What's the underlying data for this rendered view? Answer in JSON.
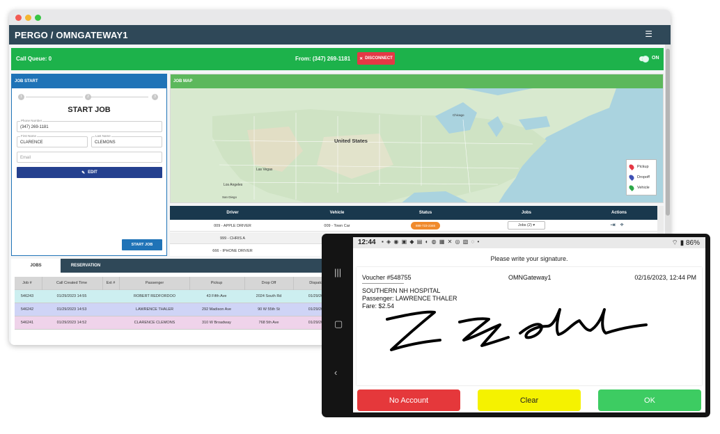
{
  "app": {
    "title": "PERGO / OMNGATEWAY1",
    "menu_icon": "hamburger-icon"
  },
  "callbar": {
    "queue": "Call Queue: 0",
    "from": "From: (347) 269-1181",
    "disconnect": "DISCONNECT",
    "toggle_label": "ON",
    "color": "#1db24b"
  },
  "job_start": {
    "header": "JOB START",
    "steps": [
      "1",
      "2",
      "3"
    ],
    "heading": "START JOB",
    "phone": {
      "label": "Phone Number",
      "value": "(347) 269-1181"
    },
    "first_name": {
      "label": "First Name",
      "value": "CLARENCE"
    },
    "last_name": {
      "label": "Last Name",
      "value": "CLEMONS"
    },
    "email": {
      "placeholder": "Email"
    },
    "edit": "EDIT",
    "start": "START JOB"
  },
  "job_map": {
    "header": "JOB MAP",
    "labels": {
      "country": "United States",
      "las_vegas": "Las Vegas",
      "los_angeles": "Los Angeles",
      "san_diego": "San Diego",
      "chicago": "Chicago"
    },
    "legend": [
      "Pickup",
      "Dropoff",
      "Vehicle"
    ],
    "legend_colors": [
      "#e53845",
      "#3f51b5",
      "#2ea84a"
    ]
  },
  "drivers": {
    "columns": [
      "Driver",
      "Vehicle",
      "Status",
      "Jobs",
      "Actions"
    ],
    "rows": [
      {
        "driver": "009 - APPLE DRIVER",
        "vehicle": "009 - Town Car",
        "status": "888-723-2346",
        "jobs": "Jobs (2)"
      },
      {
        "driver": "999 - CHRIS A",
        "vehicle": "",
        "status": "",
        "jobs": ""
      },
      {
        "driver": "666 - IPHONE DRIVER",
        "vehicle": "",
        "status": "",
        "jobs": ""
      }
    ]
  },
  "jobs": {
    "tabs": [
      "JOBS",
      "RESERVATION"
    ],
    "columns": [
      "Job #",
      "Call Created Time",
      "Ext #",
      "Passenger",
      "Pickup",
      "Drop Off",
      "Dispatch"
    ],
    "rows": [
      {
        "job": "546243",
        "time": "01/29/2023 14:55",
        "ext": "",
        "passenger": "ROBERT REDFORDOO",
        "pickup": "43 Fifth Ave",
        "dropoff": "2024 South Rd",
        "dispatch": "01/29/202"
      },
      {
        "job": "546242",
        "time": "01/29/2023 14:53",
        "ext": "",
        "passenger": "LAWRENCE THALER",
        "pickup": "292 Madison Ave",
        "dropoff": "90 W 55th St",
        "dispatch": "01/29/202"
      },
      {
        "job": "546241",
        "time": "01/29/2023 14:52",
        "ext": "",
        "passenger": "CLARENCE CLEMONS",
        "pickup": "310 W Broadway",
        "dropoff": "768 5th Ave",
        "dispatch": "01/29/202"
      }
    ],
    "row_colors": [
      "#cdeff0",
      "#cfd4f6",
      "#efd3ea"
    ]
  },
  "phone": {
    "time": "12:44",
    "battery": "86%",
    "prompt": "Please write your signature.",
    "voucher": "Voucher #548755",
    "gateway": "OMNGateway1",
    "datetime": "02/16/2023, 12:44 PM",
    "place": "SOUTHERN NH HOSPITAL",
    "passenger": "Passenger: LAWRENCE THALER",
    "fare": "Fare: $2.54",
    "buttons": {
      "no_account": "No Account",
      "clear": "Clear",
      "ok": "OK"
    },
    "button_colors": {
      "no_account": "#e5383b",
      "clear": "#f5f200",
      "ok": "#3dcc62"
    }
  }
}
